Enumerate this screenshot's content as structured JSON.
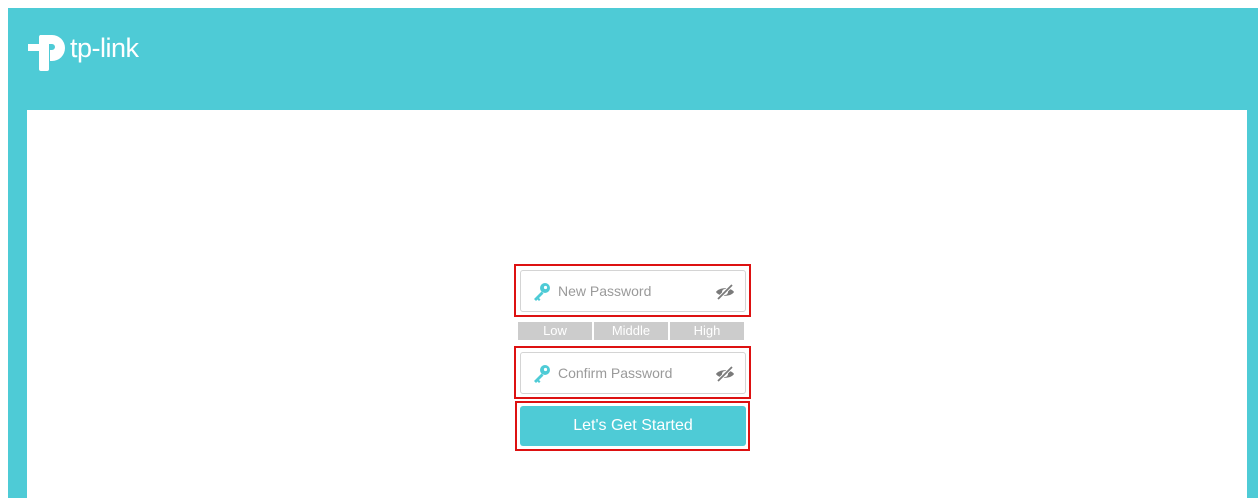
{
  "brand": {
    "name": "tp-link",
    "color": "#4ecbd6"
  },
  "form": {
    "new_password": {
      "placeholder": "New Password",
      "value": ""
    },
    "strength_levels": [
      "Low",
      "Middle",
      "High"
    ],
    "confirm_password": {
      "placeholder": "Confirm Password",
      "value": ""
    },
    "submit_label": "Let's Get Started"
  },
  "icons": {
    "field_icon": "key-icon",
    "visibility_icon": "eye-off-icon"
  },
  "highlight_color": "#dd1111"
}
